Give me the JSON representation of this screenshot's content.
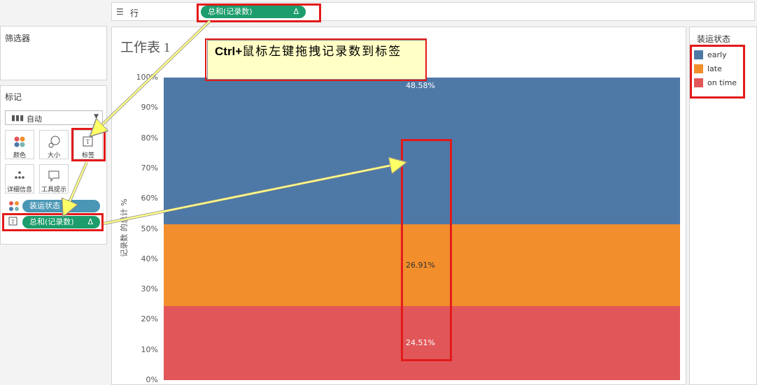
{
  "shelf": {
    "row_label": "行",
    "row_pill": "总和(记录数)",
    "delta_symbol": "Δ"
  },
  "filters": {
    "title": "筛选器"
  },
  "marks": {
    "title": "标记",
    "mark_type": "自动",
    "cards": {
      "color": "颜色",
      "size": "大小",
      "label": "标签",
      "detail": "详细信息",
      "tooltip": "工具提示"
    },
    "field_color": "装运状态",
    "field_label": "总和(记录数)"
  },
  "sheet": {
    "title": "工作表 1"
  },
  "callout": {
    "bold": "Ctrl+",
    "text": "鼠标左键拖拽记录数到标签"
  },
  "legend": {
    "title": "装运状态",
    "items": [
      {
        "label": "early",
        "color": "#4e79a7"
      },
      {
        "label": "late",
        "color": "#f28e2b"
      },
      {
        "label": "on time",
        "color": "#e15759"
      }
    ]
  },
  "chart_data": {
    "type": "bar",
    "stacked": true,
    "categories": [
      ""
    ],
    "ylabel": "记录数 的总计 %",
    "ylim": [
      0,
      100
    ],
    "yticks": [
      "0%",
      "10%",
      "20%",
      "30%",
      "40%",
      "50%",
      "60%",
      "70%",
      "80%",
      "90%",
      "100%"
    ],
    "grid": false,
    "legend_position": "right",
    "series": [
      {
        "name": "on time",
        "values": [
          24.51
        ],
        "label": "24.51%",
        "color": "#e15759"
      },
      {
        "name": "late",
        "values": [
          26.91
        ],
        "label": "26.91%",
        "color": "#f28e2b"
      },
      {
        "name": "early",
        "values": [
          48.58
        ],
        "label": "48.58%",
        "color": "#4e79a7"
      }
    ]
  }
}
